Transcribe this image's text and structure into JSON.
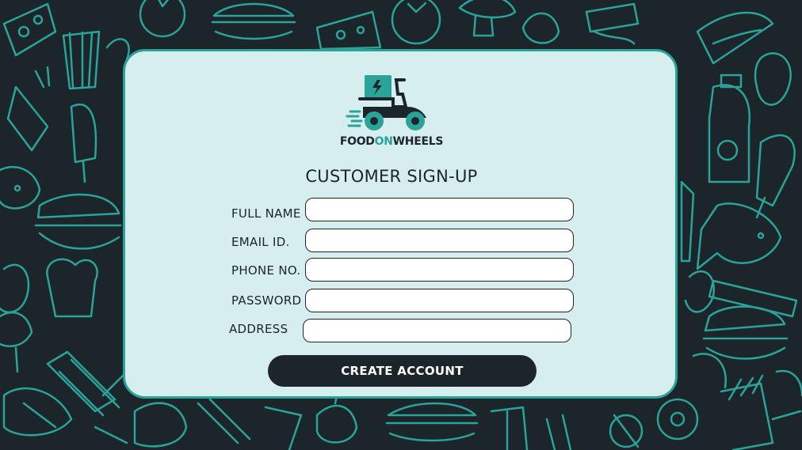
{
  "brand": {
    "part1": "FOOD",
    "part2": "ON",
    "part3": "WHEELS"
  },
  "form": {
    "title": "CUSTOMER SIGN-UP",
    "fields": [
      {
        "label": "FULL NAME",
        "value": "",
        "placeholder": ""
      },
      {
        "label": "EMAIL ID.",
        "value": "",
        "placeholder": ""
      },
      {
        "label": "PHONE NO.",
        "value": "",
        "placeholder": ""
      },
      {
        "label": "PASSWORD",
        "value": "",
        "placeholder": ""
      },
      {
        "label": "ADDRESS",
        "value": "",
        "placeholder": ""
      }
    ],
    "submit_label": "CREATE ACCOUNT"
  },
  "colors": {
    "background": "#1c252a",
    "accent": "#2aa39b",
    "card": "#d7eeee",
    "text": "#1c252a"
  }
}
